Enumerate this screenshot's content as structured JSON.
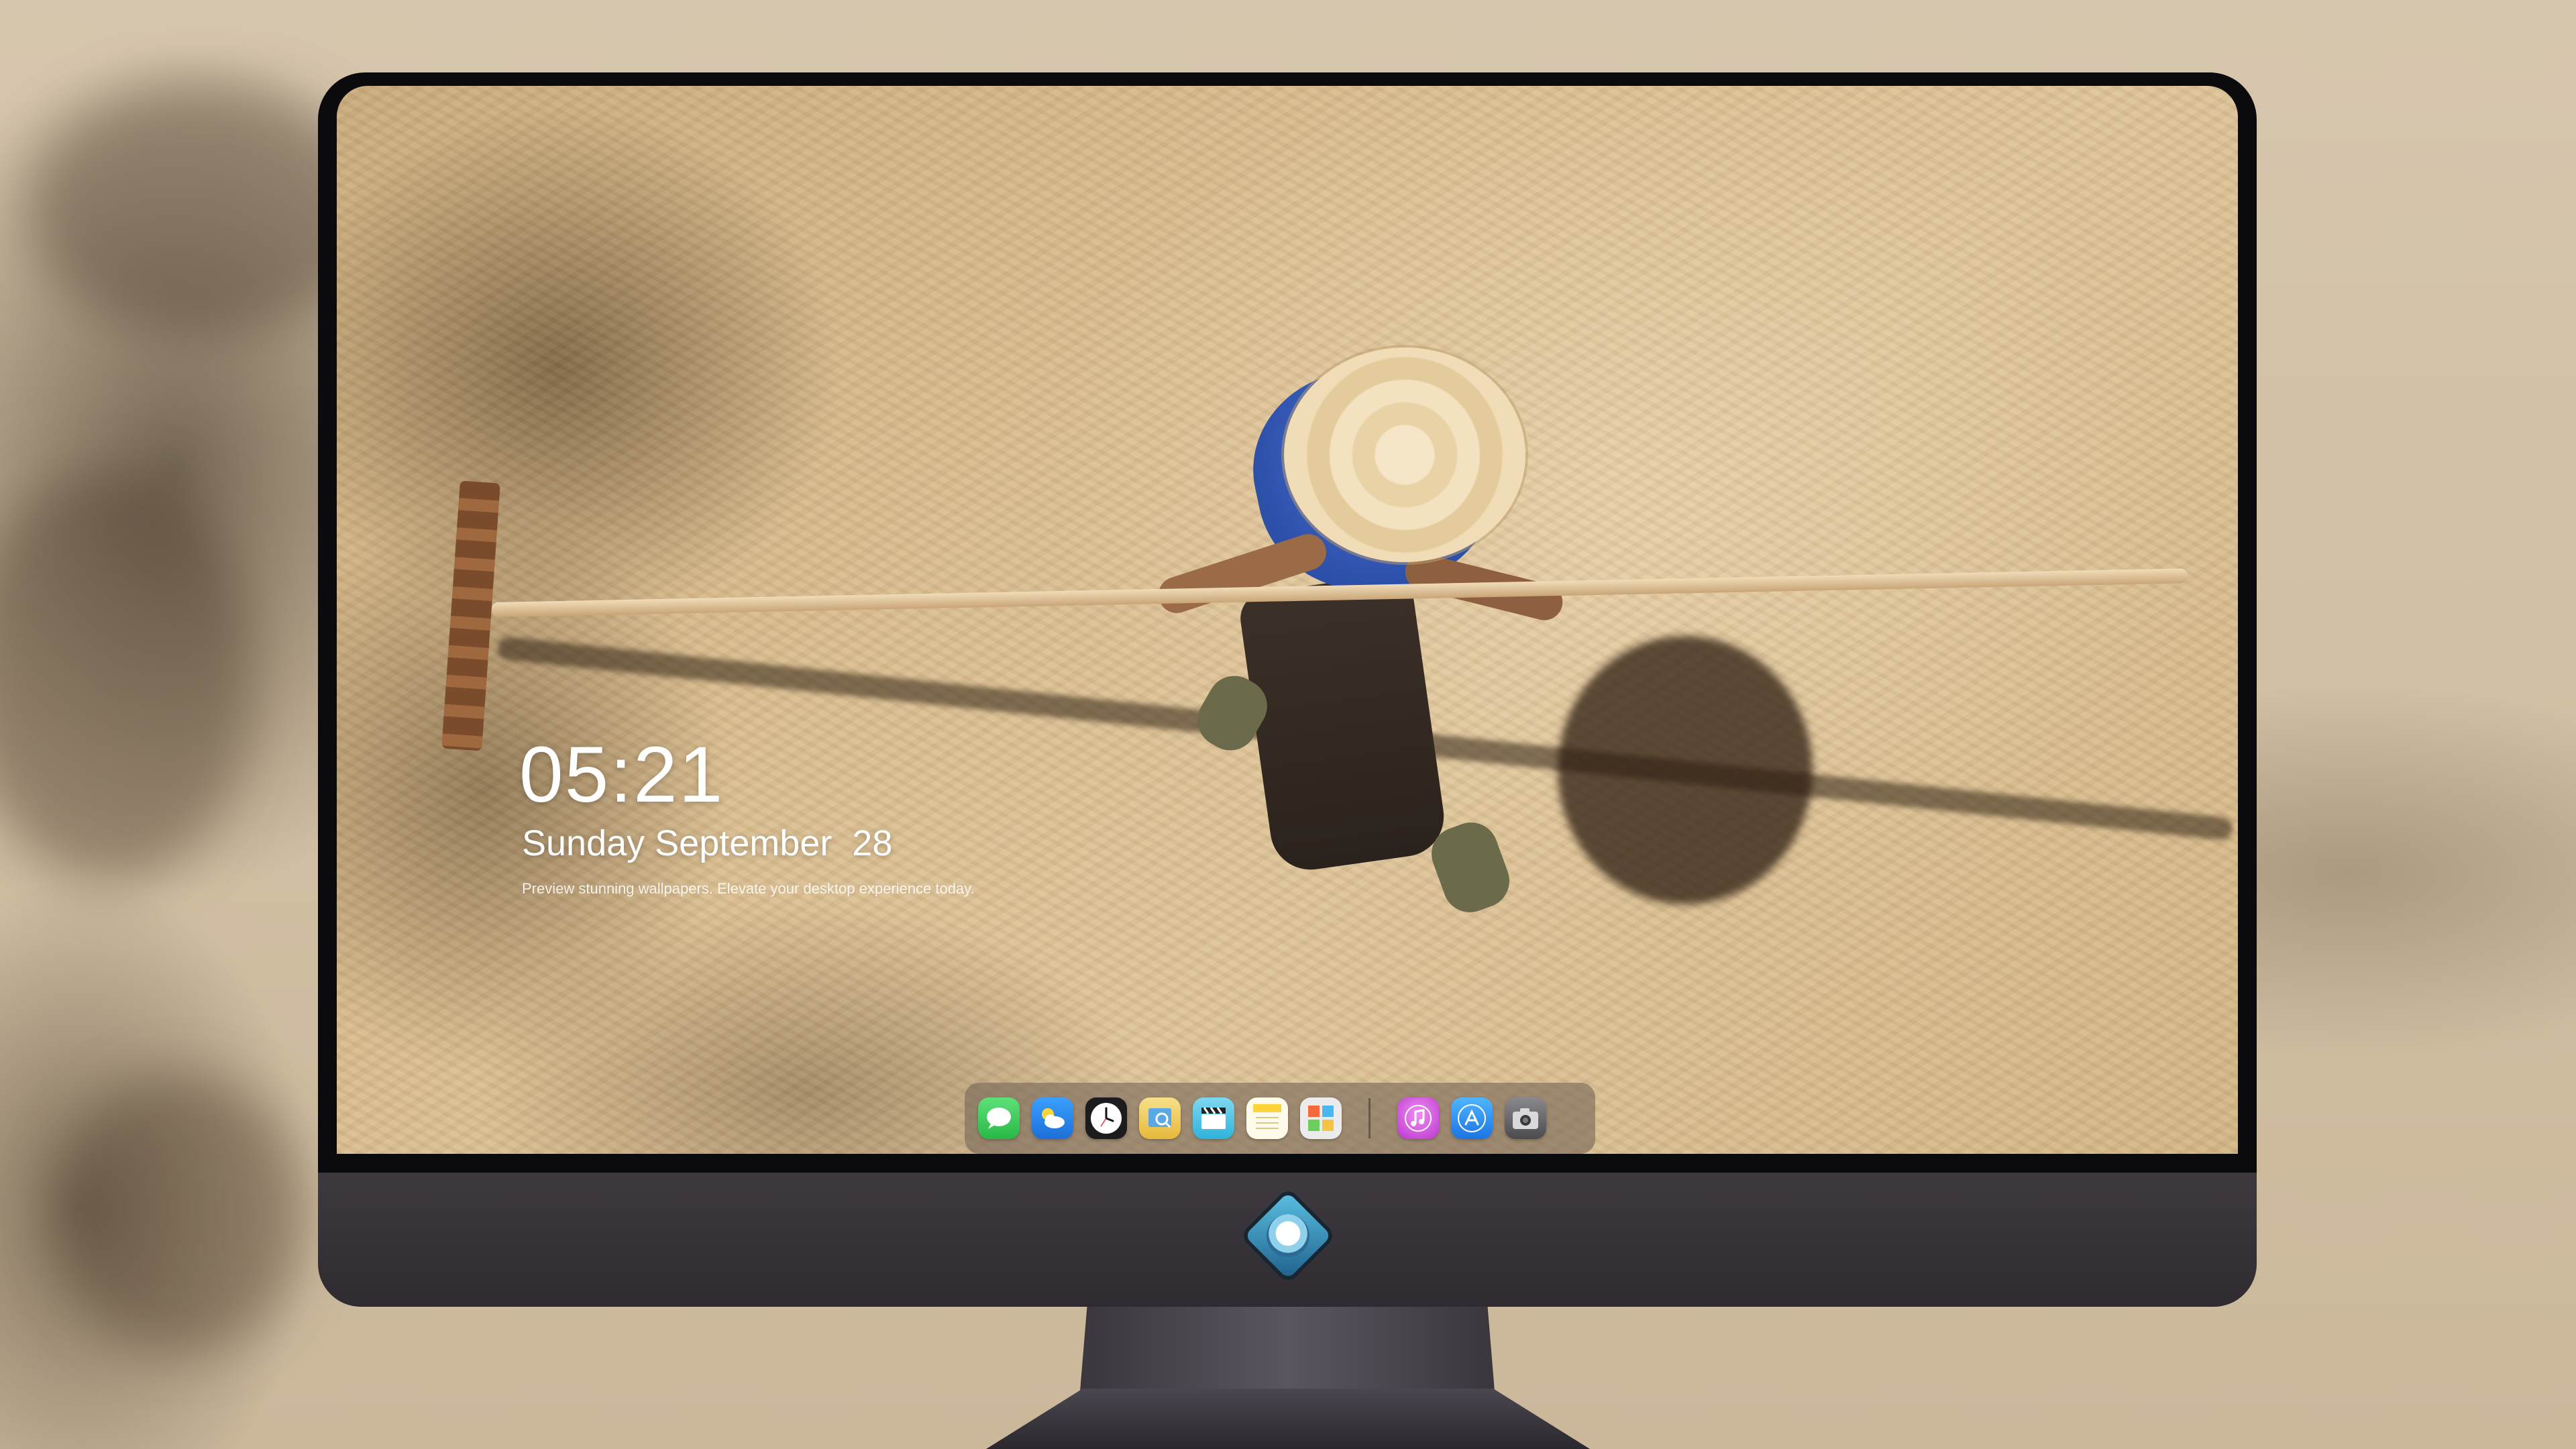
{
  "lock_screen": {
    "time": "05:21",
    "date": "Sunday September  28",
    "tagline": "Preview stunning wallpapers. Elevate your desktop experience today."
  },
  "dock": {
    "apps": [
      {
        "name": "Messages",
        "icon": "messages-icon",
        "color": "#34c759"
      },
      {
        "name": "Weather",
        "icon": "weather-icon",
        "color": "#2f8ff0"
      },
      {
        "name": "Clock",
        "icon": "clock-icon",
        "color": "#1c1c1e"
      },
      {
        "name": "Preview",
        "icon": "preview-icon",
        "color": "#f2c94c"
      },
      {
        "name": "Video",
        "icon": "clapperboard-icon",
        "color": "#4ac8e8"
      },
      {
        "name": "Notes",
        "icon": "notes-icon",
        "color": "#ffd94a"
      },
      {
        "name": "Photo Booth",
        "icon": "photos-icon",
        "color": "#e6e6e6"
      },
      {
        "name": "Music",
        "icon": "music-icon",
        "color": "#d94ad9"
      },
      {
        "name": "App Store",
        "icon": "app-store-icon",
        "color": "#1e90ff"
      },
      {
        "name": "Camera",
        "icon": "camera-icon",
        "color": "#5a5a5e"
      }
    ]
  },
  "colors": {
    "bezel": "#0b0b0d",
    "chin": "#3e393f",
    "dock_bg": "#786858",
    "clock_text": "#ffffff"
  }
}
